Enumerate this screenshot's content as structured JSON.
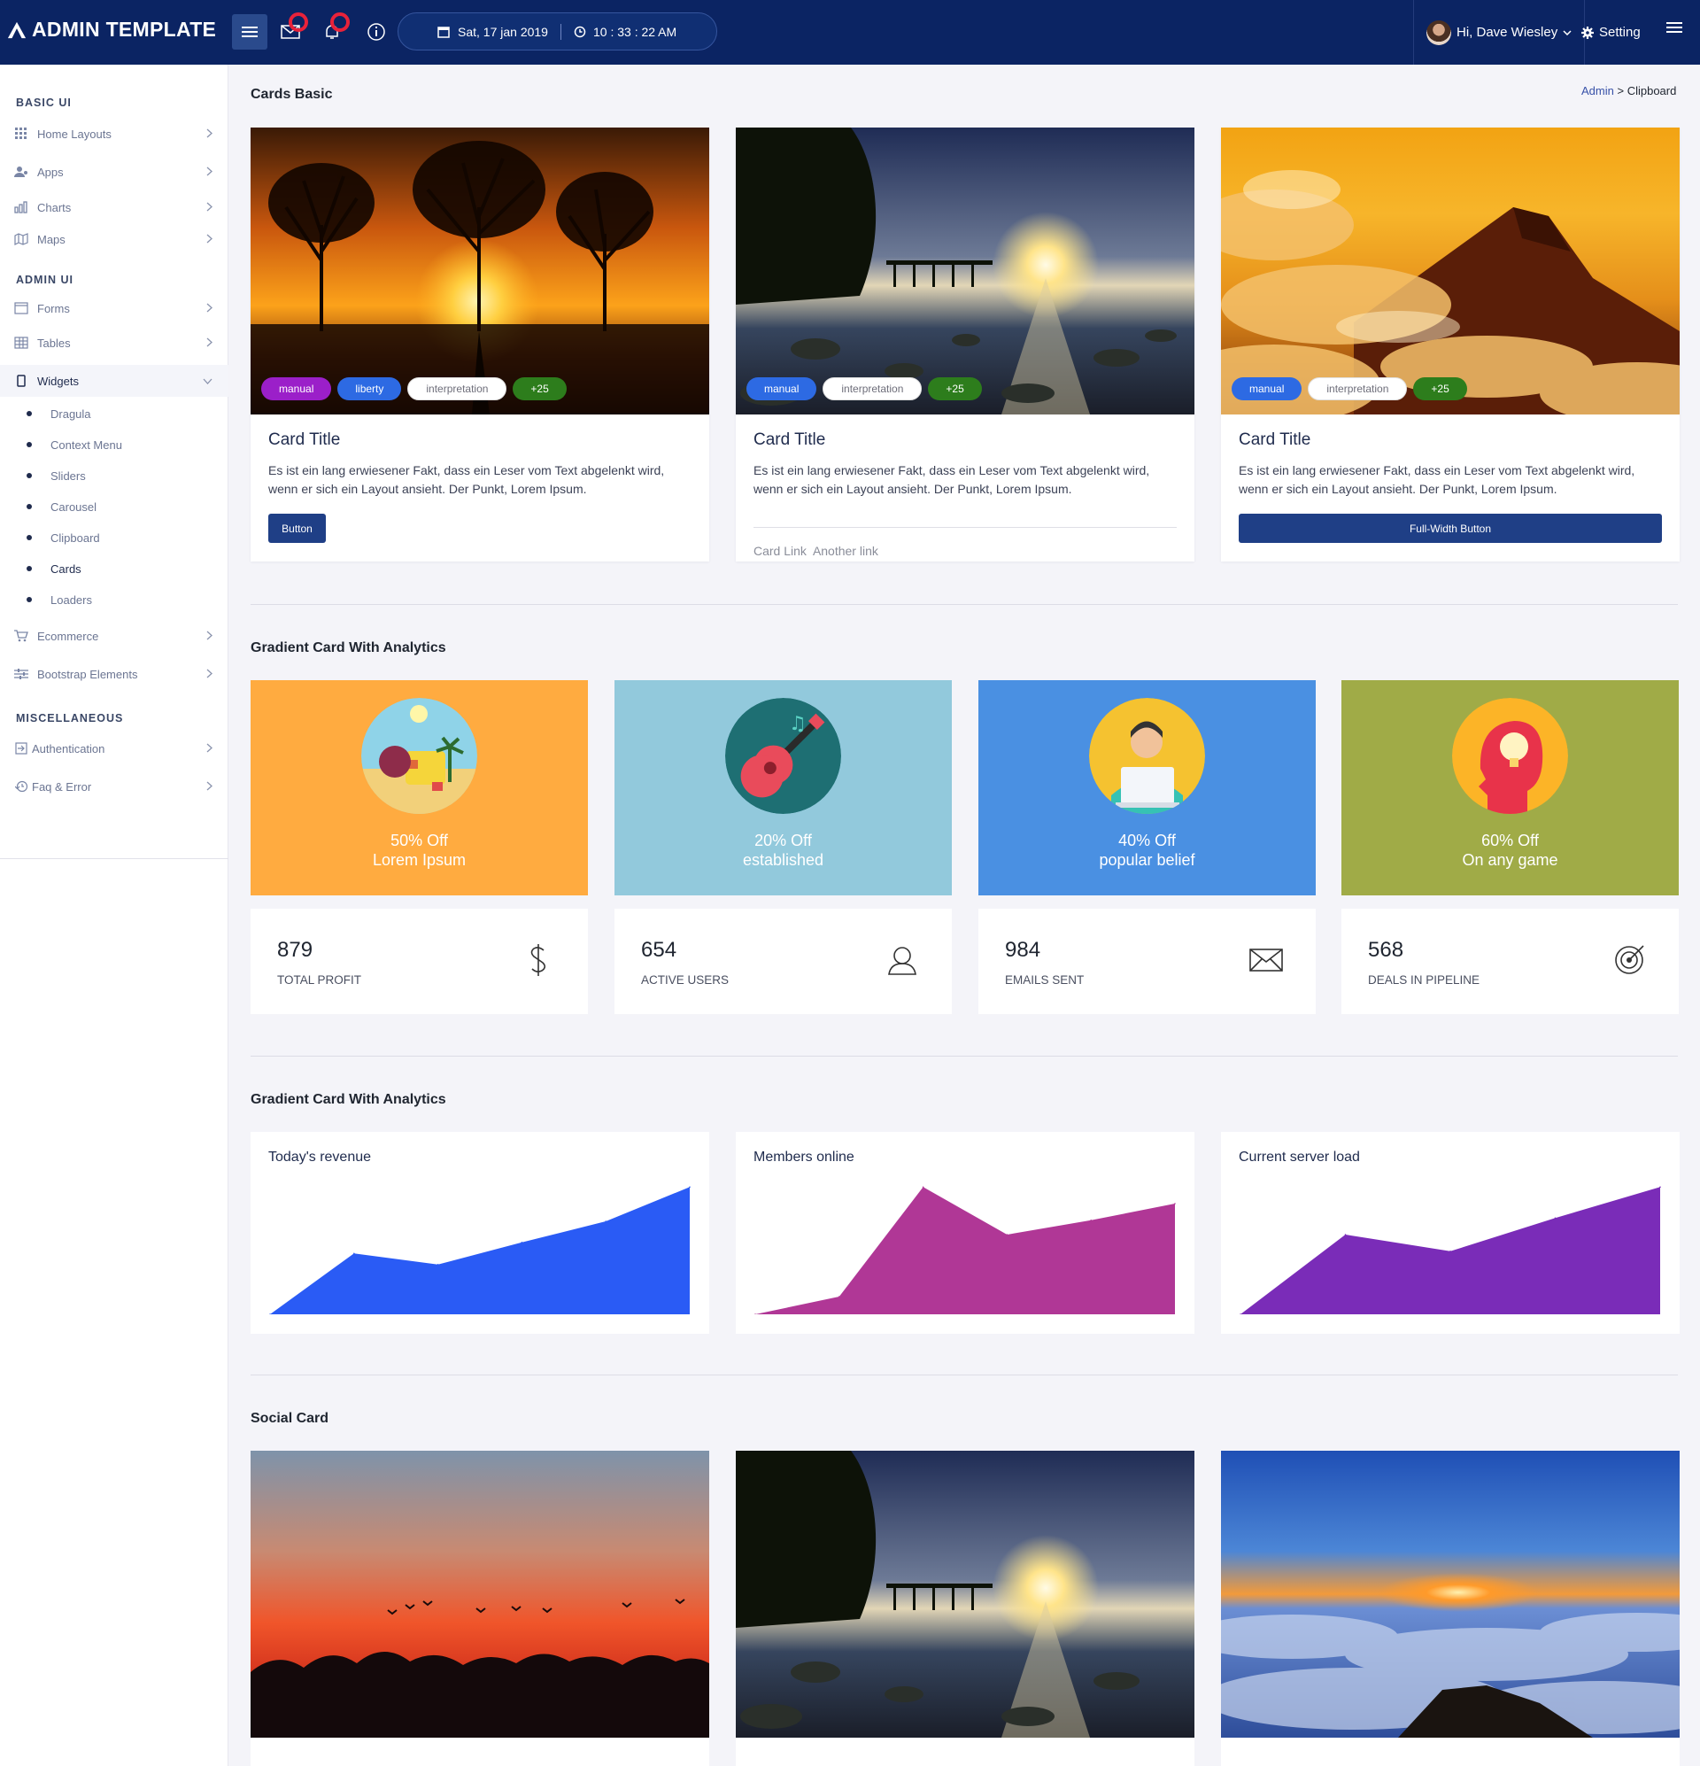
{
  "app": {
    "title": "ADMIN TEMPLATE"
  },
  "topbar": {
    "date": "Sat, 17 jan 2019",
    "time": "10 : 33 : 22 AM",
    "user_greeting": "Hi, Dave Wiesley",
    "setting_label": "Setting"
  },
  "sidebar": {
    "sections": [
      "BASIC UI",
      "ADMIN UI",
      "MISCELLANEOUS"
    ],
    "basic": [
      {
        "label": "Home Layouts",
        "icon": "grid-icon"
      },
      {
        "label": "Apps",
        "icon": "users-icon"
      },
      {
        "label": "Charts",
        "icon": "bar-chart-icon"
      },
      {
        "label": "Maps",
        "icon": "map-icon"
      }
    ],
    "admin": [
      {
        "label": "Forms",
        "icon": "form-icon"
      },
      {
        "label": "Tables",
        "icon": "table-icon"
      },
      {
        "label": "Widgets",
        "icon": "mobile-icon",
        "expanded": true
      }
    ],
    "widgets_sub": [
      "Dragula",
      "Context Menu",
      "Sliders",
      "Carousel",
      "Clipboard",
      "Cards",
      "Loaders"
    ],
    "admin_after": [
      {
        "label": "Ecommerce",
        "icon": "cart-icon"
      },
      {
        "label": "Bootstrap Elements",
        "icon": "sliders-icon"
      }
    ],
    "misc": [
      {
        "label": "Authentication",
        "icon": "login-icon"
      },
      {
        "label": "Faq & Error",
        "icon": "history-icon"
      }
    ]
  },
  "breadcrumb": {
    "root": "Admin",
    "sep": ">",
    "current": "Clipboard"
  },
  "sections": {
    "cards_basic": "Cards Basic",
    "gradient1": "Gradient Card With Analytics",
    "gradient2": "Gradient Card With Analytics",
    "social": "Social Card"
  },
  "basic_cards": [
    {
      "tags": [
        "manual",
        "liberty",
        "interpretation",
        "+25"
      ],
      "title": "Card Title",
      "text": "Es ist ein lang erwiesener Fakt, dass ein Leser vom Text abgelenkt wird, wenn er sich ein Layout ansieht. Der Punkt, Lorem Ipsum.",
      "button": "Button"
    },
    {
      "tags": [
        "manual",
        "interpretation",
        "+25"
      ],
      "title": "Card Title",
      "text": "Es ist ein lang erwiesener Fakt, dass ein Leser vom Text abgelenkt wird, wenn er sich ein Layout ansieht. Der Punkt, Lorem Ipsum.",
      "link1": "Card Link",
      "link2": "Another link"
    },
    {
      "tags": [
        "manual",
        "interpretation",
        "+25"
      ],
      "title": "Card Title",
      "text": "Es ist ein lang erwiesener Fakt, dass ein Leser vom Text abgelenkt wird, wenn er sich ein Layout ansieht. Der Punkt, Lorem Ipsum.",
      "button": "Full-Width Button"
    }
  ],
  "tag_colors": {
    "manual": "#9b1fc9",
    "liberty": "#2d6ae3",
    "+25": "#2d7d1c",
    "manual_blue": "#2d6ae3"
  },
  "promos": [
    {
      "line1": "50% Off",
      "line2": "Lorem Ipsum",
      "bg": "#ffab40",
      "icon": "beach-icon"
    },
    {
      "line1": "20% Off",
      "line2": "established",
      "bg": "#92c9dc",
      "icon": "guitar-icon"
    },
    {
      "line1": "40% Off",
      "line2": "popular belief",
      "bg": "#4a90e2",
      "icon": "person-laptop-icon"
    },
    {
      "line1": "60% Off",
      "line2": "On any game",
      "bg": "#a0ab47",
      "icon": "head-idea-icon"
    }
  ],
  "stats": [
    {
      "value": "879",
      "label": "TOTAL PROFIT",
      "icon": "dollar-icon"
    },
    {
      "value": "654",
      "label": "ACTIVE USERS",
      "icon": "user-icon"
    },
    {
      "value": "984",
      "label": "EMAILS SENT",
      "icon": "mail-icon"
    },
    {
      "value": "568",
      "label": "DEALS IN PIPELINE",
      "icon": "target-icon"
    }
  ],
  "chart_data": [
    {
      "type": "area",
      "title": "Today's revenue",
      "color": "#2a5bf5",
      "values": [
        0,
        55,
        45,
        65,
        84,
        115
      ]
    },
    {
      "type": "area",
      "title": "Members online",
      "color": "#b03796",
      "values": [
        0,
        16,
        115,
        72,
        85,
        100
      ]
    },
    {
      "type": "area",
      "title": "Current server load",
      "color": "#7a2cb8",
      "values": [
        0,
        72,
        57,
        87,
        115
      ]
    }
  ]
}
